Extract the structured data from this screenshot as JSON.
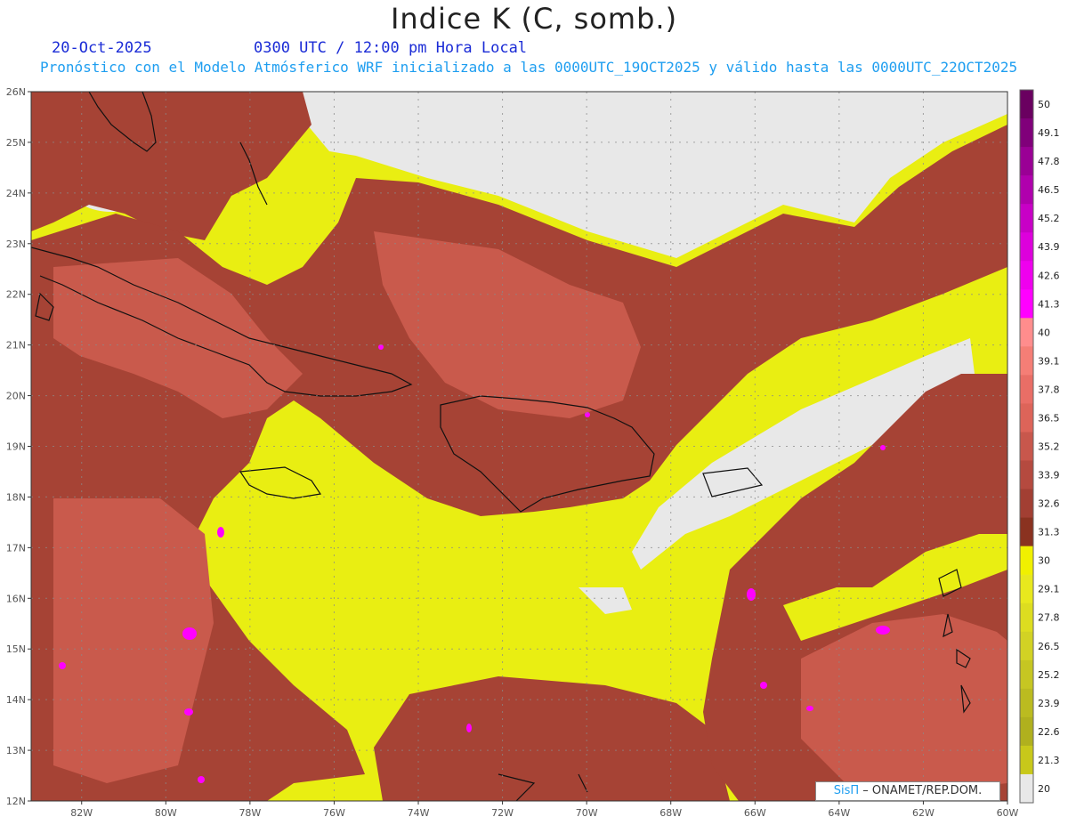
{
  "header": {
    "title": "Indice K (C, somb.)",
    "date": "20-Oct-2025",
    "time": "0300 UTC / 12:00 pm Hora Local",
    "description": "Pronóstico con el Modelo Atmósferico WRF inicializado a las 0000UTC_19OCT2025 y válido hasta las  0000UTC_22OCT2025"
  },
  "map": {
    "lat_labels": [
      "26N",
      "25N",
      "24N",
      "23N",
      "22N",
      "21N",
      "20N",
      "19N",
      "18N",
      "17N",
      "16N",
      "15N",
      "14N",
      "13N",
      "12N"
    ],
    "lon_labels": [
      "82W",
      "80W",
      "78W",
      "76W",
      "74W",
      "72W",
      "70W",
      "68W",
      "66W",
      "64W",
      "62W",
      "60W"
    ],
    "lat_range": [
      12,
      26
    ],
    "lon_range": [
      -83.2,
      -60
    ],
    "no_data_color": "#e8e8e8"
  },
  "legend": {
    "values": [
      "50",
      "49.1",
      "47.8",
      "46.5",
      "45.2",
      "43.9",
      "42.6",
      "41.3",
      "40",
      "39.1",
      "37.8",
      "36.5",
      "35.2",
      "33.9",
      "32.6",
      "31.3",
      "30",
      "29.1",
      "27.8",
      "26.5",
      "25.2",
      "23.9",
      "22.6",
      "21.3",
      "20"
    ],
    "colors": [
      "#6a0060",
      "#80007a",
      "#9a0095",
      "#b000ad",
      "#c800c6",
      "#dd00dc",
      "#ef00ee",
      "#ff00ff",
      "#ff8d8d",
      "#f57e76",
      "#e96e66",
      "#dd6459",
      "#c8574c",
      "#b54a3f",
      "#a23f33",
      "#8a3220",
      "#f0f000",
      "#e8e81e",
      "#dddd20",
      "#d2d224",
      "#c6c622",
      "#bbbb20",
      "#b0b01e",
      "#c8c81a",
      "#e8e8e8"
    ]
  },
  "credit": {
    "brand": "SisΠ",
    "text": " – ONAMET/REP.DOM."
  }
}
